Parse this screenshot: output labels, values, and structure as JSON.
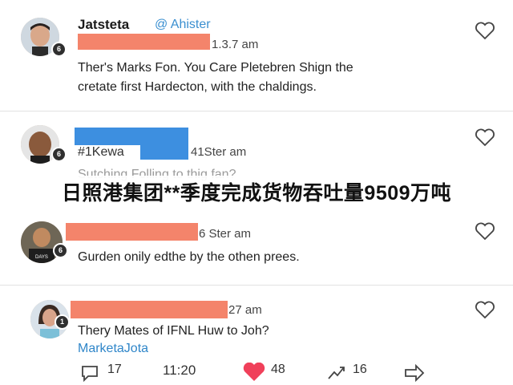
{
  "comments": [
    {
      "username": "Jatsteta",
      "handle": "@ Ahister",
      "time": "1.3.7 am",
      "text_line1": "Ther's Marks Fon. You Care Pletebren Shign the",
      "text_line2": "cretate first Hardecton, with the chaldings."
    },
    {
      "username_part": "#1Kewa",
      "time": "41Ster am",
      "text": "Sutching Folling to thig fan?"
    },
    {
      "time": "6 Ster am",
      "text": "Gurden onily edthe by the othen prees."
    },
    {
      "time": "27 am",
      "text": "Thery Mates of IFNL Huw to Joh?",
      "mention": "MarketaJota"
    }
  ],
  "caption": "日照港集团**季度完成货物吞吐量9509万吨",
  "actions": {
    "reply_count": "17",
    "retweet_count": "11:20",
    "like_count": "48",
    "share_count": "16"
  },
  "colors": {
    "like": "#f0405a",
    "link": "#3a8fd0",
    "redact_red": "#f4846b",
    "redact_blue": "#3d8fe0"
  }
}
